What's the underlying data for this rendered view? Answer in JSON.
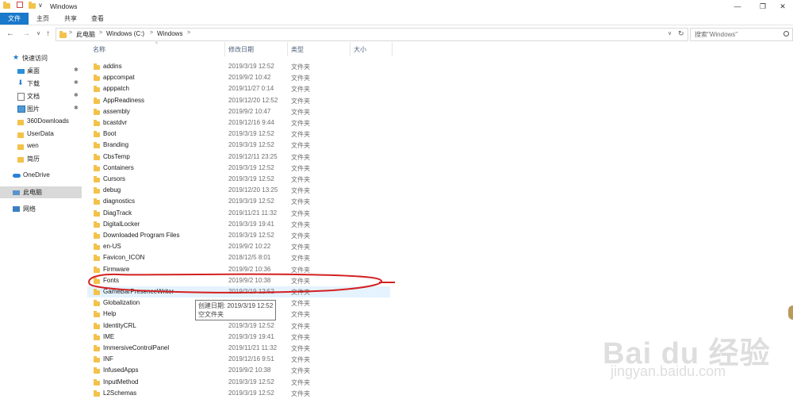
{
  "window": {
    "title": "Windows",
    "qat_dropdown": "∨",
    "minimize": "—",
    "restore": "❐",
    "close": "✕"
  },
  "ribbon": {
    "tabs": [
      "文件",
      "主页",
      "共享",
      "查看"
    ]
  },
  "address": {
    "back": "←",
    "forward": "→",
    "recent": "∨",
    "up": "↑",
    "crumbs": [
      "此电脑",
      "Windows (C:)",
      "Windows"
    ],
    "separator": ">",
    "dropdown": "∨",
    "refresh": "↻",
    "search_placeholder": "搜索\"Windows\"",
    "search_icon": "magnifier"
  },
  "sidebar": {
    "items": [
      {
        "label": "快速访问",
        "icon": "star-icon"
      },
      {
        "label": "桌面",
        "icon": "desktop-icon",
        "pinned": true
      },
      {
        "label": "下载",
        "icon": "download-icon",
        "pinned": true
      },
      {
        "label": "文档",
        "icon": "document-icon",
        "pinned": true
      },
      {
        "label": "图片",
        "icon": "picture-icon",
        "pinned": true
      },
      {
        "label": "360Downloads",
        "icon": "folder-icon"
      },
      {
        "label": "UserData",
        "icon": "folder-icon"
      },
      {
        "label": "wen",
        "icon": "folder-icon"
      },
      {
        "label": "简历",
        "icon": "folder-icon"
      },
      {
        "label": "OneDrive",
        "icon": "cloud-icon"
      },
      {
        "label": "此电脑",
        "icon": "pc-icon",
        "selected": true
      },
      {
        "label": "网络",
        "icon": "network-icon"
      }
    ],
    "pin_glyph": "✱"
  },
  "columns": {
    "name": "名称",
    "date": "修改日期",
    "type": "类型",
    "size": "大小",
    "sort_indicator": "^"
  },
  "files": [
    {
      "name": "addins",
      "date": "2019/3/19 12:52",
      "type": "文件夹"
    },
    {
      "name": "appcompat",
      "date": "2019/9/2 10:42",
      "type": "文件夹"
    },
    {
      "name": "apppatch",
      "date": "2019/11/27 0:14",
      "type": "文件夹"
    },
    {
      "name": "AppReadiness",
      "date": "2019/12/20 12:52",
      "type": "文件夹"
    },
    {
      "name": "assembly",
      "date": "2019/9/2 10:47",
      "type": "文件夹"
    },
    {
      "name": "bcastdvr",
      "date": "2019/12/16 9:44",
      "type": "文件夹"
    },
    {
      "name": "Boot",
      "date": "2019/3/19 12:52",
      "type": "文件夹"
    },
    {
      "name": "Branding",
      "date": "2019/3/19 12:52",
      "type": "文件夹"
    },
    {
      "name": "CbsTemp",
      "date": "2019/12/11 23:25",
      "type": "文件夹"
    },
    {
      "name": "Containers",
      "date": "2019/3/19 12:52",
      "type": "文件夹"
    },
    {
      "name": "Cursors",
      "date": "2019/3/19 12:52",
      "type": "文件夹"
    },
    {
      "name": "debug",
      "date": "2019/12/20 13:25",
      "type": "文件夹"
    },
    {
      "name": "diagnostics",
      "date": "2019/3/19 12:52",
      "type": "文件夹"
    },
    {
      "name": "DiagTrack",
      "date": "2019/11/21 11:32",
      "type": "文件夹"
    },
    {
      "name": "DigitalLocker",
      "date": "2019/3/19 19:41",
      "type": "文件夹"
    },
    {
      "name": "Downloaded Program Files",
      "date": "2019/3/19 12:52",
      "type": "文件夹"
    },
    {
      "name": "en-US",
      "date": "2019/9/2 10:22",
      "type": "文件夹"
    },
    {
      "name": "Favicon_ICON",
      "date": "2018/12/5 8:01",
      "type": "文件夹"
    },
    {
      "name": "Firmware",
      "date": "2019/9/2 10:36",
      "type": "文件夹"
    },
    {
      "name": "Fonts",
      "date": "2019/9/2 10:38",
      "type": "文件夹"
    },
    {
      "name": "GameBarPresenceWriter",
      "date": "2019/3/19 12:52",
      "type": "文件夹",
      "hover": true
    },
    {
      "name": "Globalization",
      "date": "",
      "type": "文件夹"
    },
    {
      "name": "Help",
      "date": "",
      "type": "文件夹"
    },
    {
      "name": "IdentityCRL",
      "date": "2019/3/19 12:52",
      "type": "文件夹"
    },
    {
      "name": "IME",
      "date": "2019/3/19 19:41",
      "type": "文件夹"
    },
    {
      "name": "ImmersiveControlPanel",
      "date": "2019/11/21 11:32",
      "type": "文件夹"
    },
    {
      "name": "INF",
      "date": "2019/12/16 9:51",
      "type": "文件夹"
    },
    {
      "name": "InfusedApps",
      "date": "2019/9/2 10:38",
      "type": "文件夹"
    },
    {
      "name": "InputMethod",
      "date": "2019/3/19 12:52",
      "type": "文件夹"
    },
    {
      "name": "L2Schemas",
      "date": "2019/3/19 12:52",
      "type": "文件夹"
    }
  ],
  "tooltip": {
    "line1": "创建日期: 2019/3/19 12:52",
    "line2": "空文件夹"
  },
  "watermark": {
    "logo": "Bai du 经验",
    "url": "jingyan.baidu.com"
  },
  "colors": {
    "file_tab": "#1979ca",
    "annotation": "#d42020",
    "hover_row": "#e5f3ff",
    "selected_nav": "#d9d9d9",
    "folder": "#f3c24b"
  }
}
